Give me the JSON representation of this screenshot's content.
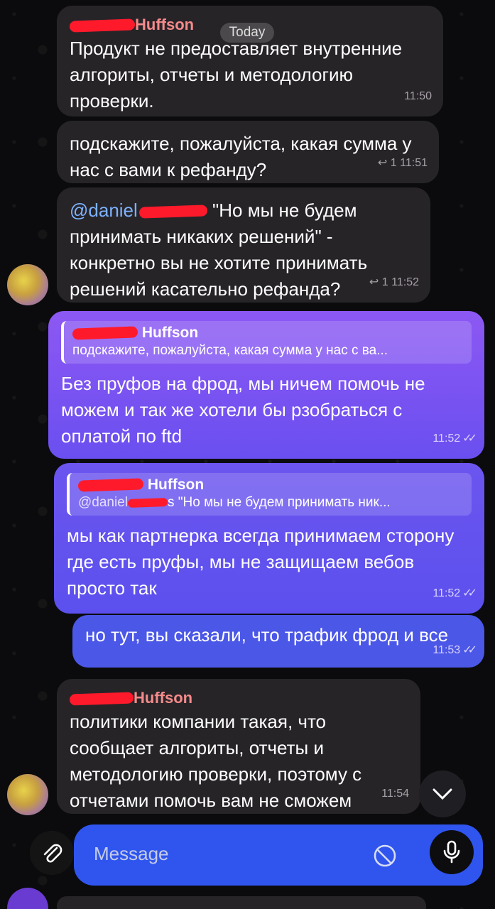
{
  "header": {
    "date_chip": "Today"
  },
  "messages": [
    {
      "sender": "Huffson",
      "text": "Продукт не предоставляет внутренние алгориты, отчеты и методологию проверки.",
      "time": "11:50"
    },
    {
      "text": "подскажите, пожалуйста, какая сумма у нас с вами к рефанду?",
      "replies": "1",
      "time": "11:51"
    },
    {
      "mention": "@daniel",
      "text": "\"Но мы не будем принимать никаких решений\" - конкретно вы не хотите принимать решений касательно рефанда?",
      "replies": "1",
      "time": "11:52"
    },
    {
      "quote_sender": "Huffson",
      "quote_text": "подскажите, пожалуйста, какая сумма у нас с ва...",
      "text": "Без пруфов на фрод, мы ничем помочь не можем и так же хотели бы рзобраться с оплатой по ftd",
      "time": "11:52"
    },
    {
      "quote_sender": "Huffson",
      "quote_mention": "@daniel",
      "quote_text": "s \"Но мы не будем принимать ник...",
      "text": "мы как партнерка всегда принимаем сторону где есть пруфы, мы не защищаем вебов просто так",
      "time": "11:52"
    },
    {
      "text": "но тут, вы сказали, что трафик фрод и все",
      "time": "11:53"
    },
    {
      "sender": "Huffson",
      "text": "политики компании такая, что сообщает алгориты, отчеты и методологию проверки, поэтому с отчетами помочь вам не сможем",
      "time": "11:54"
    }
  ],
  "composer": {
    "placeholder": "Message"
  },
  "icons": {
    "attach": "paperclip-icon",
    "sticker": "sticker-icon",
    "mic": "microphone-icon",
    "scroll": "chevron-down-icon",
    "reply": "reply-arrow-icon",
    "read": "double-check-icon"
  },
  "colors": {
    "incoming_bubble": "#272428",
    "outgoing_bubble": "#8d58f3",
    "sender_name": "#f58b8b",
    "mention": "#7db2ff",
    "redaction": "#ff1a2b",
    "input_bar": "#2f55ee"
  }
}
